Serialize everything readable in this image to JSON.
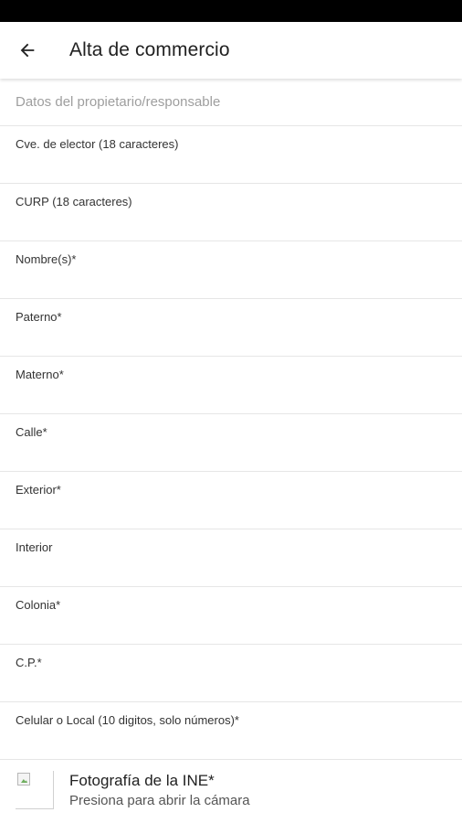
{
  "app_bar": {
    "title": "Alta de commercio",
    "back_icon": "arrow-back-icon"
  },
  "form": {
    "section_title": "Datos del propietario/responsable",
    "fields": [
      {
        "label": "Cve. de elector (18 caracteres)",
        "value": ""
      },
      {
        "label": "CURP (18 caracteres)",
        "value": ""
      },
      {
        "label": "Nombre(s)*",
        "value": ""
      },
      {
        "label": "Paterno*",
        "value": ""
      },
      {
        "label": "Materno*",
        "value": ""
      },
      {
        "label": "Calle*",
        "value": ""
      },
      {
        "label": "Exterior*",
        "value": ""
      },
      {
        "label": "Interior",
        "value": ""
      },
      {
        "label": "Colonia*",
        "value": ""
      },
      {
        "label": "C.P.*",
        "value": ""
      },
      {
        "label": "Celular o Local (10 digitos, solo números)*",
        "value": ""
      }
    ],
    "photo": {
      "title": "Fotografía de la INE*",
      "subtitle": "Presiona para abrir la cámara",
      "icon": "broken-image-icon"
    }
  }
}
